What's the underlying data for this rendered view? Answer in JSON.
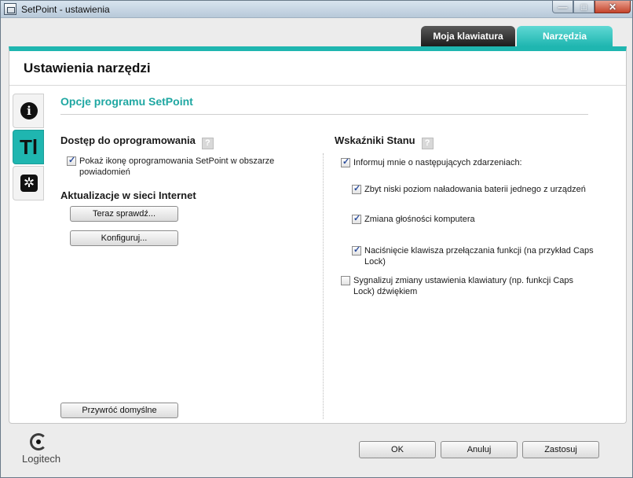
{
  "window": {
    "title": "SetPoint - ustawienia",
    "minimize_glyph": "—",
    "maximize_glyph": "□",
    "close_glyph": "✕"
  },
  "tabs": [
    {
      "label": "Moja klawiatura",
      "active": false
    },
    {
      "label": "Narzędzia",
      "active": true
    }
  ],
  "panel": {
    "title": "Ustawienia narzędzi",
    "section_title": "Opcje programu SetPoint"
  },
  "side_icons": [
    {
      "name": "info-icon",
      "glyph": "i",
      "active": false
    },
    {
      "name": "tools-icon",
      "glyph": "Tl",
      "active": true
    },
    {
      "name": "snowflake-icon",
      "glyph": "✲",
      "active": false
    }
  ],
  "left": {
    "access_title": "Dostęp do oprogramowania",
    "access_checkbox": {
      "label": "Pokaż ikonę oprogramowania SetPoint w obszarze powiadomień",
      "checked": true
    },
    "updates_title": "Aktualizacje w sieci Internet",
    "check_now_button": "Teraz sprawdź...",
    "configure_button": "Konfiguruj..."
  },
  "right": {
    "status_title": "Wskaźniki Stanu",
    "notify_checkbox": {
      "label": "Informuj mnie o następujących zdarzeniach:",
      "checked": true
    },
    "battery_checkbox": {
      "label": "Zbyt niski poziom naładowania baterii jednego z urządzeń",
      "checked": true
    },
    "volume_checkbox": {
      "label": "Zmiana głośności komputera",
      "checked": true
    },
    "fkey_checkbox": {
      "label": "Naciśnięcie klawisza przełączania funkcji (na przykład Caps Lock)",
      "checked": true
    },
    "sound_checkbox": {
      "label": "Sygnalizuj zmiany ustawienia klawiatury (np. funkcji Caps Lock) dźwiękiem",
      "checked": false
    }
  },
  "help_glyph": "?",
  "restore_button": "Przywróć domyślne",
  "footer": {
    "logo_text": "Logitech",
    "ok_button": "OK",
    "cancel_button": "Anuluj",
    "apply_button": "Zastosuj"
  },
  "colors": {
    "accent": "#1fb6b0",
    "section_title": "#1fa7a2"
  }
}
